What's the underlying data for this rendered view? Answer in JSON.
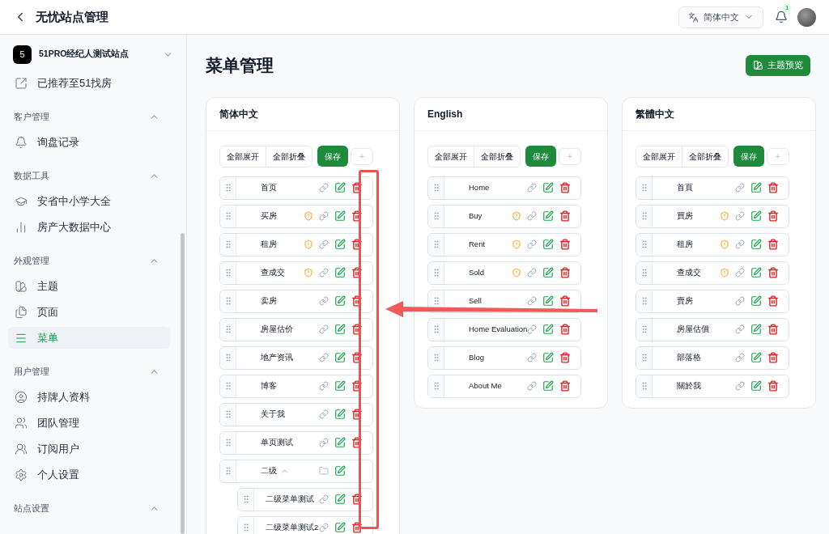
{
  "header": {
    "title": "无忧站点管理",
    "language": "简体中文",
    "notifications": "1"
  },
  "sidebar": {
    "site": {
      "badge": "5",
      "name": "51PRO经纪人测试站点"
    },
    "items": [
      {
        "label": "已推荐至51找房",
        "selected": false
      }
    ],
    "sections": [
      {
        "title": "客户管理",
        "expanded": true,
        "items": [
          {
            "label": "询盘记录",
            "selected": false
          }
        ]
      },
      {
        "title": "数据工具",
        "expanded": true,
        "items": [
          {
            "label": "安省中小学大全",
            "selected": false
          },
          {
            "label": "房产大数据中心",
            "selected": false
          }
        ]
      },
      {
        "title": "外观管理",
        "expanded": true,
        "items": [
          {
            "label": "主题",
            "selected": false
          },
          {
            "label": "页面",
            "selected": false
          },
          {
            "label": "菜单",
            "selected": true
          }
        ]
      },
      {
        "title": "用户管理",
        "expanded": true,
        "items": [
          {
            "label": "持牌人资料",
            "selected": false
          },
          {
            "label": "团队管理",
            "selected": false
          },
          {
            "label": "订阅用户",
            "selected": false
          },
          {
            "label": "个人设置",
            "selected": false
          }
        ]
      },
      {
        "title": "站点设置",
        "expanded": true
      }
    ]
  },
  "page": {
    "title": "菜单管理",
    "preview_button": "主题预览"
  },
  "panels": [
    {
      "title": "简体中文",
      "expand_all": "全部展开",
      "collapse_all": "全部折叠",
      "save": "保存",
      "add": "+",
      "items": [
        {
          "kind": "page",
          "label": "首页",
          "protected": false
        },
        {
          "kind": "page",
          "label": "买房",
          "protected": true
        },
        {
          "kind": "page",
          "label": "租房",
          "protected": true
        },
        {
          "kind": "page",
          "label": "查成交",
          "protected": true
        },
        {
          "kind": "page",
          "label": "卖房",
          "protected": false
        },
        {
          "kind": "page",
          "label": "房屋估价",
          "protected": false
        },
        {
          "kind": "page",
          "label": "地产资讯",
          "protected": false
        },
        {
          "kind": "page",
          "label": "博客",
          "protected": false
        },
        {
          "kind": "page",
          "label": "关于我",
          "protected": false
        },
        {
          "kind": "page",
          "label": "单页测试",
          "protected": false
        },
        {
          "kind": "folder",
          "label": "二级",
          "expanded": true,
          "children": [
            {
              "kind": "page",
              "label": "二级菜单测试",
              "protected": false
            },
            {
              "kind": "page",
              "label": "二级菜单测试2",
              "protected": false
            }
          ]
        }
      ]
    },
    {
      "title": "English",
      "expand_all": "全部展开",
      "collapse_all": "全部折叠",
      "save": "保存",
      "add": "+",
      "items": [
        {
          "kind": "page",
          "label": "Home",
          "protected": false
        },
        {
          "kind": "page",
          "label": "Buy",
          "protected": true
        },
        {
          "kind": "page",
          "label": "Rent",
          "protected": true
        },
        {
          "kind": "page",
          "label": "Sold",
          "protected": true
        },
        {
          "kind": "page",
          "label": "Sell",
          "protected": false
        },
        {
          "kind": "page",
          "label": "Home Evaluation",
          "protected": false
        },
        {
          "kind": "page",
          "label": "Blog",
          "protected": false
        },
        {
          "kind": "page",
          "label": "About Me",
          "protected": false
        }
      ]
    },
    {
      "title": "繁體中文",
      "expand_all": "全部展开",
      "collapse_all": "全部折叠",
      "save": "保存",
      "add": "+",
      "items": [
        {
          "kind": "page",
          "label": "首頁",
          "protected": false
        },
        {
          "kind": "page",
          "label": "買房",
          "protected": true
        },
        {
          "kind": "page",
          "label": "租房",
          "protected": true
        },
        {
          "kind": "page",
          "label": "查成交",
          "protected": true
        },
        {
          "kind": "page",
          "label": "賣房",
          "protected": false
        },
        {
          "kind": "page",
          "label": "房屋估價",
          "protected": false
        },
        {
          "kind": "page",
          "label": "部落格",
          "protected": false
        },
        {
          "kind": "page",
          "label": "關於我",
          "protected": false
        }
      ]
    }
  ],
  "annotations": {
    "highlight_box": true,
    "arrow": true
  }
}
